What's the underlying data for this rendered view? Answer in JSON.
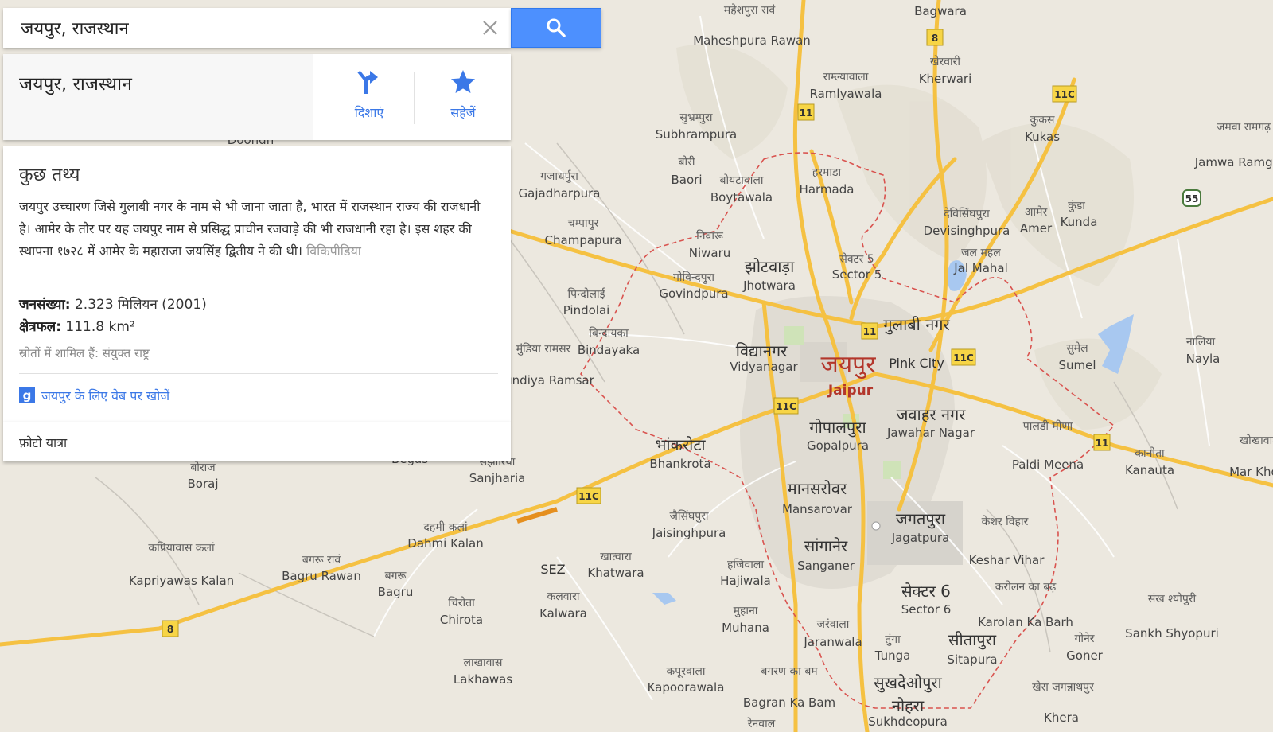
{
  "search": {
    "value": "जयपुर, राजस्थान",
    "clear_icon": "close-icon",
    "button_icon": "search-icon",
    "button_color": "#4d90fe"
  },
  "place_card": {
    "title": "जयपुर, राजस्थान",
    "directions_label": "दिशाएं",
    "save_label": "सहेजें",
    "accent_color": "#3b78e7"
  },
  "facts": {
    "heading": "कुछ तथ्य",
    "description": "जयपुर उच्चारण जिसे गुलाबी नगर के नाम से भी जाना जाता है, भारत में राजस्थान राज्य की राजधानी है। आमेर के तौर पर यह जयपुर नाम से प्रसिद्ध प्राचीन रजवाड़े की भी राजधानी रहा है। इस शहर की स्थापना १७२८ में आमेर के महाराजा जयसिंह द्वितीय ने की थी।",
    "wiki_link": "विकिपीडिया",
    "population_label": "जनसंख्या:",
    "population_value": "2.323 मिलियन (2001)",
    "area_label": "क्षेत्रफल:",
    "area_value": "111.8 km²",
    "sources": "स्रोतों में शामिल हैं: संयुक्त राष्ट्र",
    "web_search_icon_text": "g",
    "web_search_link": "जयपुर के लिए वेब पर खोजें"
  },
  "photo_tour": {
    "label": "फ़ोटो यात्रा"
  },
  "map": {
    "city_dev": "जयपुर",
    "city_en": "Jaipur",
    "city_color": "#b3362b",
    "road_color": "#f5c142",
    "boundary_color": "#d9534f",
    "places": [
      {
        "dev": "महेशपुरा रावं",
        "en": "Maheshpura Rawan"
      },
      {
        "dev": "",
        "en": "Bagwara"
      },
      {
        "dev": "खेरवारी",
        "en": "Kherwari"
      },
      {
        "dev": "राम्ल्यावाला",
        "en": "Ramlyawala"
      },
      {
        "dev": "सुभ्रम्पुरा",
        "en": "Subhrampura"
      },
      {
        "dev": "कुकस",
        "en": "Kukas"
      },
      {
        "dev": "जमवा रामगढ़",
        "en": "Jamwa Ramgarh"
      },
      {
        "dev": "बोरी",
        "en": "Baori"
      },
      {
        "dev": "बोयटावाला",
        "en": "Boytawala"
      },
      {
        "dev": "हरमाडा",
        "en": "Harmada"
      },
      {
        "dev": "गजाधर्पुरा",
        "en": "Gajadharpura"
      },
      {
        "dev": "देविसिंघपुरा",
        "en": "Devisinghpura"
      },
      {
        "dev": "आमेर",
        "en": "Amer"
      },
      {
        "dev": "कुंडा",
        "en": "Kunda"
      },
      {
        "dev": "चम्पापुर",
        "en": "Champapura"
      },
      {
        "dev": "निवारू",
        "en": "Niwaru"
      },
      {
        "dev": "झोटवाड़ा",
        "en": "Jhotwara"
      },
      {
        "dev": "सेक्टर 5",
        "en": "Sector 5"
      },
      {
        "dev": "जल महल",
        "en": "Jal Mahal"
      },
      {
        "dev": "गोविन्दपुरा",
        "en": "Govindpura"
      },
      {
        "dev": "पिन्दोलाई",
        "en": "Pindolai"
      },
      {
        "dev": "गुलाबी नगर",
        "en": "Pink City"
      },
      {
        "dev": "बिन्दायका",
        "en": "Bindayaka"
      },
      {
        "dev": "विद्यानगर",
        "en": "Vidyanagar"
      },
      {
        "dev": "सुमेल",
        "en": "Sumel"
      },
      {
        "dev": "नालिया",
        "en": "Nayla"
      },
      {
        "dev": "मुंडिया रामसर",
        "en": "Mundiya Ramsar"
      },
      {
        "dev": "जवाहर नगर",
        "en": "Jawahar Nagar"
      },
      {
        "dev": "गोपालपुरा",
        "en": "Gopalpura"
      },
      {
        "dev": "पालडी मीणा",
        "en": "Paldi Meena"
      },
      {
        "dev": "कानोता",
        "en": "Kanauta"
      },
      {
        "dev": "भांकरोटा",
        "en": "Bhankrota"
      },
      {
        "dev": "",
        "en": "Begas"
      },
      {
        "dev": "सझारिया",
        "en": "Sanjharia"
      },
      {
        "dev": "बोराज",
        "en": "Boraj"
      },
      {
        "dev": "मानसरोवर",
        "en": "Mansarovar"
      },
      {
        "dev": "जैसिंघपुरा",
        "en": "Jaisinghpura"
      },
      {
        "dev": "जगतपुरा",
        "en": "Jagatpura"
      },
      {
        "dev": "केशर विहार",
        "en": "Keshar Vihar"
      },
      {
        "dev": "दहमी कलां",
        "en": "Dahmi Kalan"
      },
      {
        "dev": "कप्रियावास कलां",
        "en": "Kapriyawas Kalan"
      },
      {
        "dev": "बगरू रावं",
        "en": "Bagru Rawan"
      },
      {
        "dev": "बगरू",
        "en": "Bagru"
      },
      {
        "dev": "",
        "en": "SEZ"
      },
      {
        "dev": "खात्वारा",
        "en": "Khatwara"
      },
      {
        "dev": "हजिवाला",
        "en": "Hajiwala"
      },
      {
        "dev": "सांगानेर",
        "en": "Sanganer"
      },
      {
        "dev": "सेक्टर 6",
        "en": "Sector 6"
      },
      {
        "dev": "करोलन का बढ़",
        "en": "Karolan Ka Barh"
      },
      {
        "dev": "संख श्योपुरी",
        "en": "Sankh Shyopuri"
      },
      {
        "dev": "चिरोता",
        "en": "Chirota"
      },
      {
        "dev": "कलवारा",
        "en": "Kalwara"
      },
      {
        "dev": "मुहाना",
        "en": "Muhana"
      },
      {
        "dev": "जरंवाला",
        "en": "Jaranwala"
      },
      {
        "dev": "तुंगा",
        "en": "Tunga"
      },
      {
        "dev": "सीतापुरा",
        "en": "Sitapura"
      },
      {
        "dev": "गोनेर",
        "en": "Goner"
      },
      {
        "dev": "लाखावास",
        "en": "Lakhawas"
      },
      {
        "dev": "कपूरवाला",
        "en": "Kapoorawala"
      },
      {
        "dev": "बगरण का बम",
        "en": "Bagran Ka Bam"
      },
      {
        "dev": "सुखदेओपुरा",
        "en": "Sukhdeopura"
      },
      {
        "dev": "खेरा जगन्नाथपुर",
        "en": "Khera"
      },
      {
        "dev": "",
        "en": "Doondh"
      },
      {
        "dev": "रेनवाल",
        "en": ""
      },
      {
        "dev": "नोहरा",
        "en": ""
      },
      {
        "dev": "खोखावाला",
        "en": "Mar Khokh"
      }
    ],
    "highway_shields": [
      "8",
      "11",
      "11C",
      "11",
      "11C",
      "11C",
      "11C",
      "11",
      "11C",
      "8",
      "55"
    ]
  }
}
